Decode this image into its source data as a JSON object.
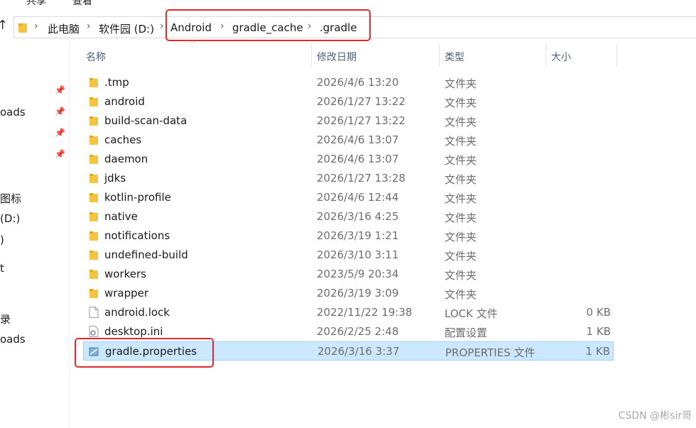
{
  "ribbon": {
    "share": "共享",
    "view": "查看"
  },
  "breadcrumb": [
    "此电脑",
    "软件园 (D:)",
    "Android",
    "gradle_cache",
    ".gradle"
  ],
  "columns": {
    "name": "名称",
    "date": "修改日期",
    "type": "类型",
    "size": "大小"
  },
  "nav": {
    "items": [
      "oads",
      "图标",
      "(D:)",
      ")",
      "t",
      "录",
      "oads"
    ]
  },
  "files": [
    {
      "name": ".tmp",
      "date": "2026/4/6 13:20",
      "type": "文件夹",
      "size": "",
      "icon": "folder-icon"
    },
    {
      "name": "android",
      "date": "2026/1/27 13:22",
      "type": "文件夹",
      "size": "",
      "icon": "folder-icon"
    },
    {
      "name": "build-scan-data",
      "date": "2026/1/27 13:22",
      "type": "文件夹",
      "size": "",
      "icon": "folder-icon"
    },
    {
      "name": "caches",
      "date": "2026/4/6 13:07",
      "type": "文件夹",
      "size": "",
      "icon": "folder-icon"
    },
    {
      "name": "daemon",
      "date": "2026/4/6 13:07",
      "type": "文件夹",
      "size": "",
      "icon": "folder-icon"
    },
    {
      "name": "jdks",
      "date": "2026/1/27 13:28",
      "type": "文件夹",
      "size": "",
      "icon": "folder-icon"
    },
    {
      "name": "kotlin-profile",
      "date": "2026/4/6 12:44",
      "type": "文件夹",
      "size": "",
      "icon": "folder-icon"
    },
    {
      "name": "native",
      "date": "2026/3/16 4:25",
      "type": "文件夹",
      "size": "",
      "icon": "folder-icon"
    },
    {
      "name": "notifications",
      "date": "2026/3/19 1:21",
      "type": "文件夹",
      "size": "",
      "icon": "folder-icon"
    },
    {
      "name": "undefined-build",
      "date": "2026/3/10 3:11",
      "type": "文件夹",
      "size": "",
      "icon": "folder-icon"
    },
    {
      "name": "workers",
      "date": "2023/5/9 20:34",
      "type": "文件夹",
      "size": "",
      "icon": "folder-icon"
    },
    {
      "name": "wrapper",
      "date": "2026/3/19 3:09",
      "type": "文件夹",
      "size": "",
      "icon": "folder-icon"
    },
    {
      "name": "android.lock",
      "date": "2022/11/22 19:38",
      "type": "LOCK 文件",
      "size": "0 KB",
      "icon": "file-icon"
    },
    {
      "name": "desktop.ini",
      "date": "2026/2/25 2:48",
      "type": "配置设置",
      "size": "1 KB",
      "icon": "settings-file-icon"
    },
    {
      "name": "gradle.properties",
      "date": "2026/3/16 3:37",
      "type": "PROPERTIES 文件",
      "size": "1 KB",
      "icon": "properties-file-icon",
      "selected": true
    }
  ],
  "watermark": "CSDN @彬sir哥",
  "colors": {
    "selection": "#cce8ff",
    "highlight": "#e8272b",
    "folder": "#f5c542"
  }
}
